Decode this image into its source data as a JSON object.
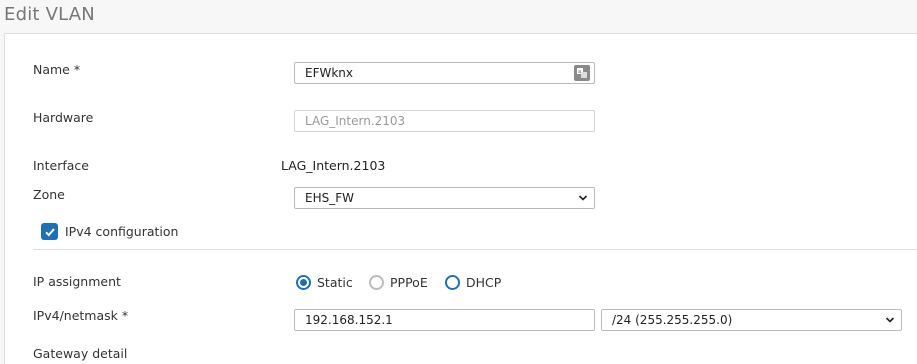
{
  "page": {
    "title": "Edit VLAN"
  },
  "form": {
    "name": {
      "label": "Name *",
      "value": "EFWknx"
    },
    "hardware": {
      "label": "Hardware",
      "placeholder": "LAG_Intern.2103"
    },
    "interface": {
      "label": "Interface",
      "value": "LAG_Intern.2103"
    },
    "zone": {
      "label": "Zone",
      "value": "EHS_FW"
    },
    "ipv4_config": {
      "label": "IPv4 configuration",
      "checked": true
    },
    "ip_assignment": {
      "label": "IP assignment",
      "options": [
        "Static",
        "PPPoE",
        "DHCP"
      ],
      "selected": "Static"
    },
    "ipv4_netmask": {
      "label": "IPv4/netmask *",
      "ip": "192.168.152.1",
      "netmask": "/24 (255.255.255.0)"
    },
    "gateway_detail": {
      "label": "Gateway detail"
    }
  },
  "colors": {
    "accent": "#1f6fb5",
    "border": "#bbbbbb",
    "title": "#777777"
  },
  "icons": {
    "name_field": "text-lookup-icon",
    "select": "chevron-down-icon",
    "checkbox": "checkmark-icon"
  }
}
